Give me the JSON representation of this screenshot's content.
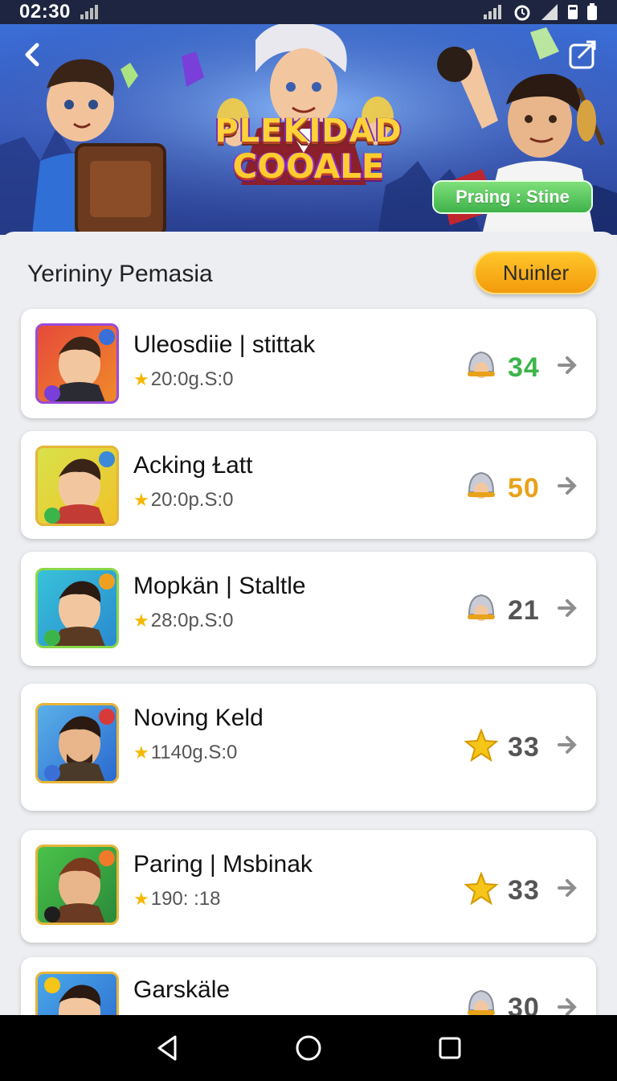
{
  "status_bar": {
    "time": "02:30"
  },
  "hero": {
    "logo_line1": "PLEKIDAD",
    "logo_line2": "COOALE",
    "status_chip": "Praing : Stine"
  },
  "list": {
    "title": "Yerininy Pemasia",
    "action_button": "Nuinler",
    "items": [
      {
        "title": "Uleosdiie | stittak",
        "subtitle": "20:0g.S:0",
        "score": "34",
        "score_color": "#3bb54a",
        "badge": "helmet-icon"
      },
      {
        "title": "Acking Ɫatt",
        "subtitle": "20:0p.S:0",
        "score": "50",
        "score_color": "#e8a21a",
        "badge": "helmet-icon"
      },
      {
        "title": "Mopkän | Staltle",
        "subtitle": "28:0p.S:0",
        "score": "21",
        "score_color": "#555555",
        "badge": "helmet-icon"
      },
      {
        "title": "Noving Keld",
        "subtitle": "1140g.S:0",
        "score": "33",
        "score_color": "#555555",
        "badge": "star-icon"
      },
      {
        "title": "Paring | Msbinak",
        "subtitle": "190: :18",
        "score": "33",
        "score_color": "#555555",
        "badge": "star-icon"
      },
      {
        "title": "Garskäle",
        "subtitle": "",
        "score": "30",
        "score_color": "#555555",
        "badge": "helmet-icon"
      }
    ]
  },
  "nav": {
    "back": "back-icon",
    "home": "home-icon",
    "recents": "recents-icon"
  }
}
